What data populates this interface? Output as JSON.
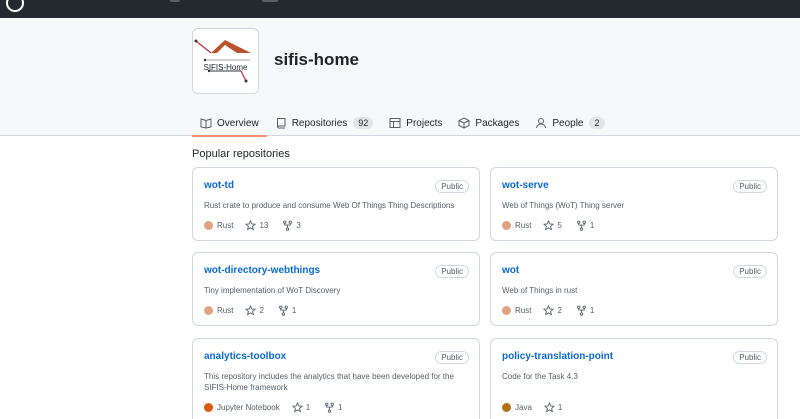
{
  "org": {
    "name": "sifis-home",
    "logo_text": "SIFIS-Home"
  },
  "tabs": [
    {
      "label": "Overview",
      "icon": "book-open-icon",
      "counter": null,
      "selected": true
    },
    {
      "label": "Repositories",
      "icon": "repo-icon",
      "counter": "92",
      "selected": false
    },
    {
      "label": "Projects",
      "icon": "table-icon",
      "counter": null,
      "selected": false
    },
    {
      "label": "Packages",
      "icon": "package-icon",
      "counter": null,
      "selected": false
    },
    {
      "label": "People",
      "icon": "person-icon",
      "counter": "2",
      "selected": false
    }
  ],
  "popular": {
    "title": "Popular repositories",
    "repos": [
      {
        "name": "wot-td",
        "visibility": "Public",
        "description": "Rust crate to produce and consume Web Of Things Thing Descriptions",
        "language": "Rust",
        "language_color": "#dea584",
        "stars": "13",
        "forks": "3"
      },
      {
        "name": "wot-serve",
        "visibility": "Public",
        "description": "Web of Things (WoT) Thing server",
        "language": "Rust",
        "language_color": "#dea584",
        "stars": "5",
        "forks": "1"
      },
      {
        "name": "wot-directory-webthings",
        "visibility": "Public",
        "description": "Tiny implementation of WoT Discovery",
        "language": "Rust",
        "language_color": "#dea584",
        "stars": "2",
        "forks": "1"
      },
      {
        "name": "wot",
        "visibility": "Public",
        "description": "Web of Things in rust",
        "language": "Rust",
        "language_color": "#dea584",
        "stars": "2",
        "forks": "1"
      },
      {
        "name": "analytics-toolbox",
        "visibility": "Public",
        "description": "This repository includes the analytics that have been developed for the SIFIS-Home framework",
        "language": "Jupyter Notebook",
        "language_color": "#DA5B0B",
        "stars": "1",
        "forks": "1"
      },
      {
        "name": "policy-translation-point",
        "visibility": "Public",
        "description": "Code for the Task 4.3",
        "language": "Java",
        "language_color": "#b07219",
        "stars": "1",
        "forks": null
      }
    ]
  },
  "colors": {
    "accent": "#0969da",
    "tab_underline": "#fd8c73",
    "topbar": "#24292f"
  }
}
